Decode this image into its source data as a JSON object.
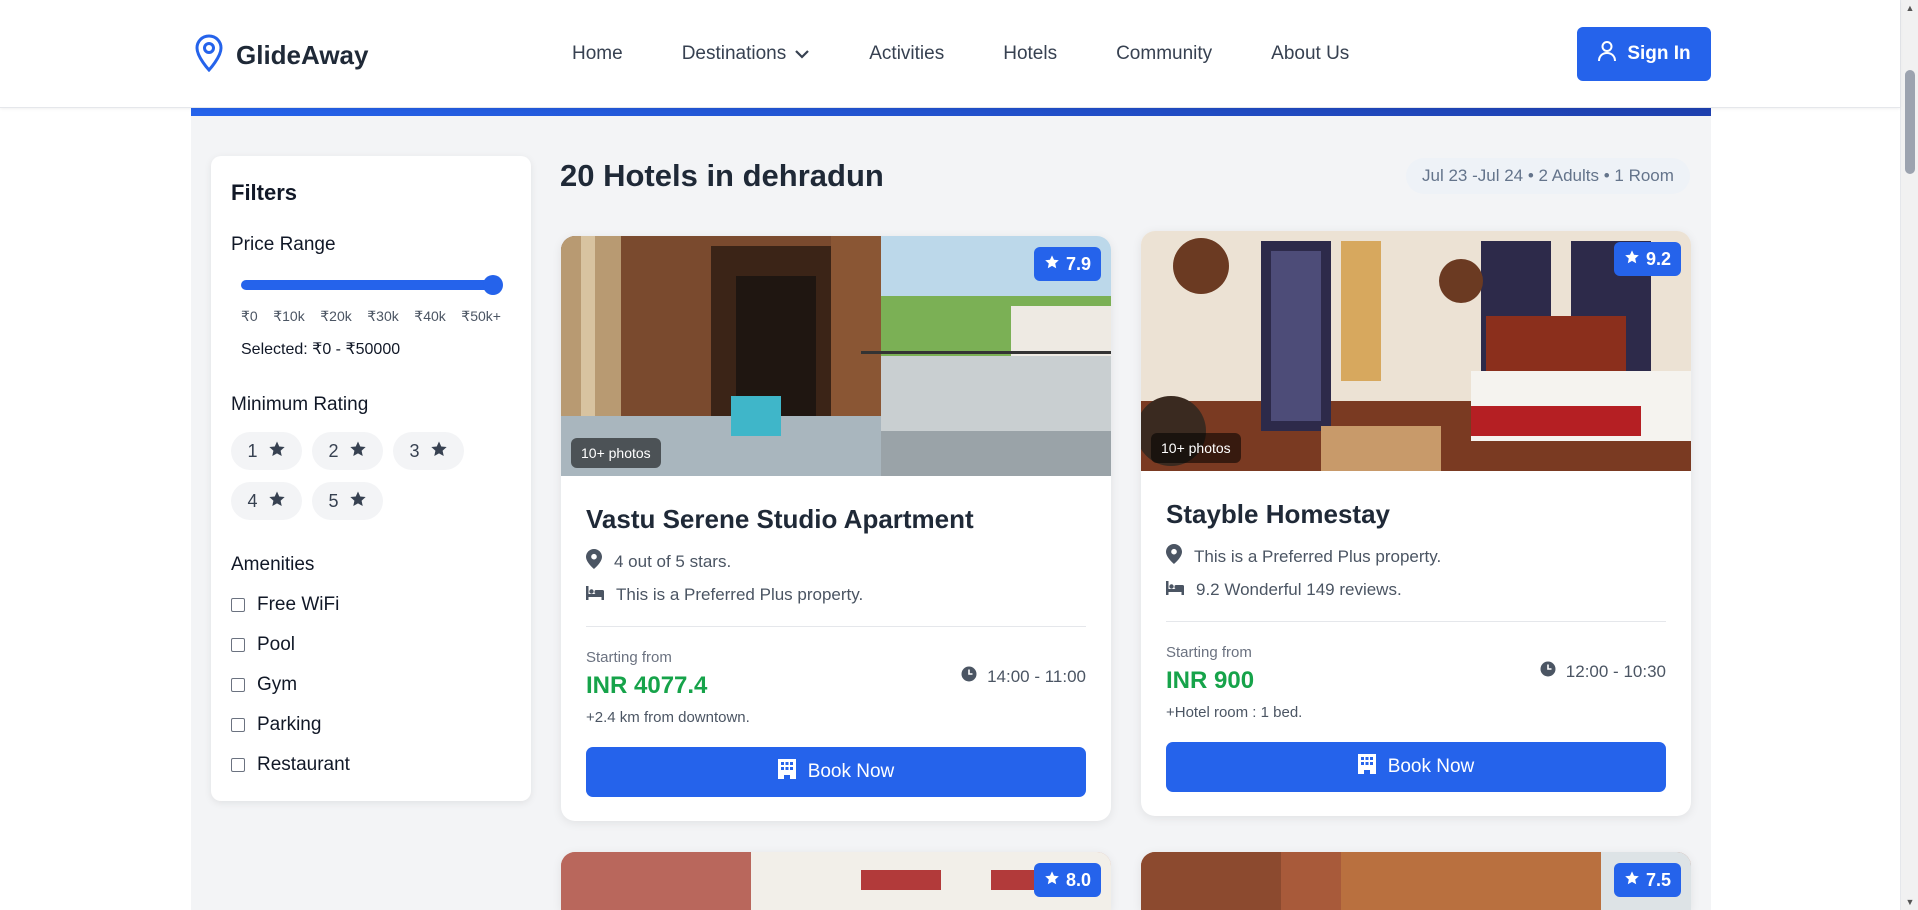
{
  "header": {
    "brand": "GlideAway",
    "nav": [
      {
        "label": "Home",
        "icon": ""
      },
      {
        "label": "Destinations",
        "icon": "chevron-down-icon"
      },
      {
        "label": "Activities",
        "icon": ""
      },
      {
        "label": "Hotels",
        "icon": ""
      },
      {
        "label": "Community",
        "icon": ""
      },
      {
        "label": "About Us",
        "icon": ""
      }
    ],
    "signin_label": "Sign In"
  },
  "filters": {
    "title": "Filters",
    "price_range": {
      "label": "Price Range",
      "ticks": [
        "₹0",
        "₹10k",
        "₹20k",
        "₹30k",
        "₹40k",
        "₹50k+"
      ],
      "selected_text": "Selected: ₹0 - ₹50000",
      "slider_fraction": 1.0
    },
    "rating": {
      "label": "Minimum Rating",
      "options": [
        "1",
        "2",
        "3",
        "4",
        "5"
      ]
    },
    "amenities": {
      "label": "Amenities",
      "items": [
        "Free WiFi",
        "Pool",
        "Gym",
        "Parking",
        "Restaurant"
      ]
    }
  },
  "results": {
    "title": "20 Hotels in dehradun",
    "summary": "Jul 23 -Jul 24 • 2 Adults • 1 Room"
  },
  "hotels": [
    {
      "rating": "7.9",
      "photos": "10+ photos",
      "name": "Vastu Serene Studio Apartment",
      "line1": "4 out of 5 stars.",
      "line2": "This is a Preferred Plus property.",
      "starting_label": "Starting from",
      "price": "INR 4077.4",
      "times": "14:00 - 11:00",
      "note": "+2.4 km from downtown.",
      "book_label": "Book Now"
    },
    {
      "rating": "9.2",
      "photos": "10+ photos",
      "name": "Stayble Homestay",
      "line1": "This is a Preferred Plus property.",
      "line2": "9.2 Wonderful 149 reviews.",
      "starting_label": "Starting from",
      "price": "INR 900",
      "times": "12:00 - 10:30",
      "note": "+Hotel room : 1 bed.",
      "book_label": "Book Now"
    },
    {
      "rating": "8.0"
    },
    {
      "rating": "7.5"
    }
  ],
  "colors": {
    "primary": "#2563eb",
    "price_green": "#16a34a",
    "page_bg": "#f3f4f6"
  }
}
